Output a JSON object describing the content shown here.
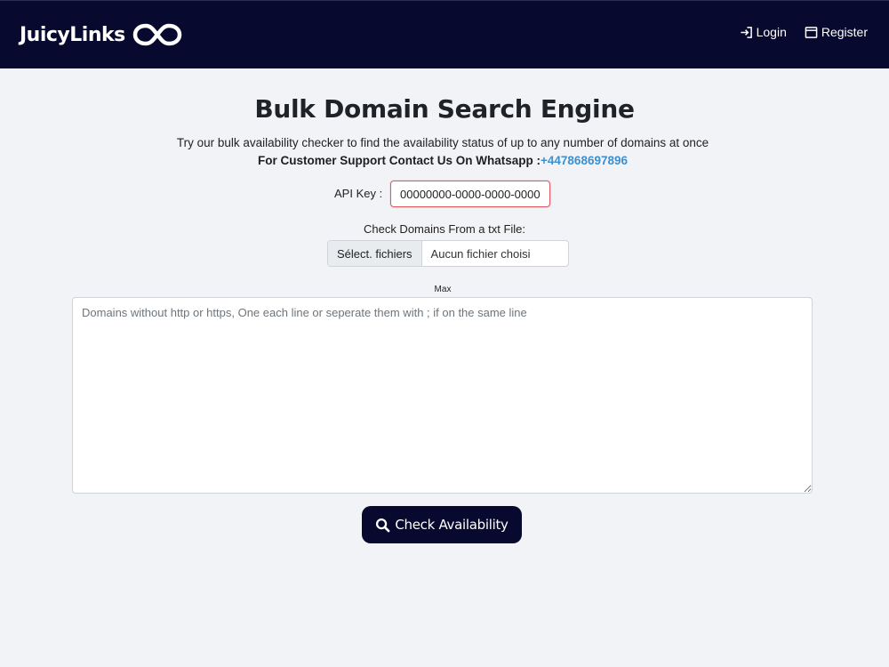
{
  "nav": {
    "brand": "JuicyLinks",
    "login": "Login",
    "register": "Register"
  },
  "main": {
    "title": "Bulk Domain Search Engine",
    "subtitle": "Try our bulk availability checker to find the availability status of up to any number of domains at once",
    "support_text": "For Customer Support Contact Us On Whatsapp :",
    "support_phone": "+447868697896",
    "api_key_label": "API Key :",
    "api_key_value": "00000000-0000-0000-0000-",
    "file_label": "Check Domains From a txt File:",
    "file_button": "Sélect. fichiers",
    "file_status": "Aucun fichier choisi",
    "max_label": "Max",
    "domains_placeholder": "Domains without http or https, One each line or seperate them with ; if on the same line",
    "check_button": "Check Availability"
  },
  "colors": {
    "navbar": "#07092e",
    "page_background": "#f1f3f6",
    "link": "#3d8fd0",
    "input_error_border": "#e05a63"
  },
  "icons": {
    "brand_logo": "infinity-link-icon",
    "login": "sign-in-icon",
    "register": "window-icon",
    "check": "search-icon"
  }
}
